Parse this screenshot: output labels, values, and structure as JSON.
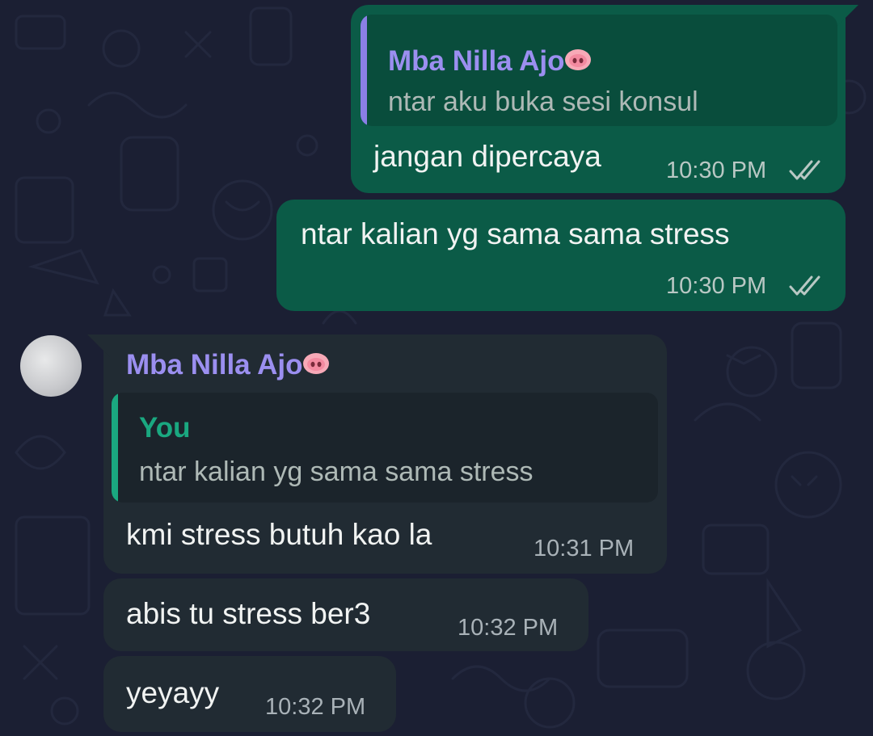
{
  "colors": {
    "background": "#1b1f33",
    "outgoing_bubble": "#0b5b47",
    "incoming_bubble": "#212b33",
    "sender_name": "#9b8ff0",
    "quote_bar_out": "#8a7fe6",
    "quote_name_you": "#1aa880",
    "tick_color": "#b9c8c4"
  },
  "messages": [
    {
      "direction": "outgoing",
      "quote": {
        "author": "Mba Nilla Ajo",
        "author_emoji": "pig-nose-emoji",
        "text": "ntar aku buka sesi konsul"
      },
      "text": "jangan dipercaya",
      "time": "10:30 PM",
      "status": "read-double-check-icon"
    },
    {
      "direction": "outgoing",
      "text": "ntar kalian yg sama sama stress",
      "time": "10:30 PM",
      "status": "read-double-check-icon"
    },
    {
      "direction": "incoming",
      "sender": "Mba Nilla Ajo",
      "sender_emoji": "pig-nose-emoji",
      "quote": {
        "author": "You",
        "text": "ntar kalian yg sama sama stress"
      },
      "text": "kmi stress butuh kao la",
      "time": "10:31 PM"
    },
    {
      "direction": "incoming",
      "text": "abis tu stress ber3",
      "time": "10:32 PM"
    },
    {
      "direction": "incoming",
      "text": "yeyayy",
      "time": "10:32 PM"
    }
  ]
}
